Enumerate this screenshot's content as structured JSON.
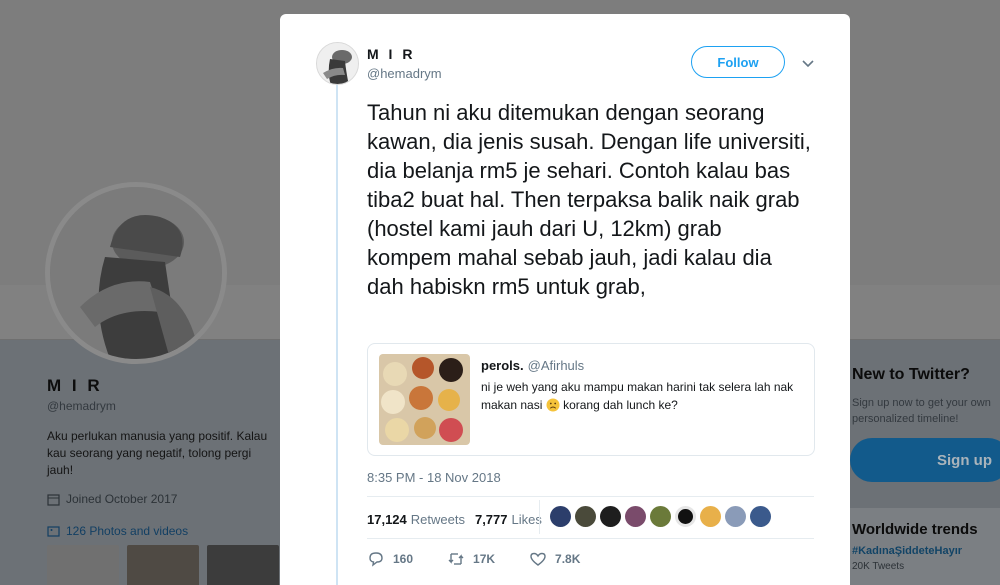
{
  "background_profile": {
    "name": "M I R",
    "handle": "@hemadrym",
    "bio": "Aku perlukan manusia yang positif. Kalau kau seorang yang negatif, tolong pergi jauh!",
    "joined": "Joined October 2017",
    "photos_link": "126 Photos and videos",
    "new_to_twitter_title": "New to Twitter?",
    "new_to_twitter_sub": "Sign up now to get your own personalized timeline!",
    "signup_button": "Sign up",
    "trends_title": "Worldwide trends",
    "trend_1": "#KadınaŞiddeteHayır",
    "trend_1_count": "20K Tweets"
  },
  "tweet": {
    "author_name": "M I R",
    "author_handle": "@hemadrym",
    "follow_label": "Follow",
    "text": "Tahun ni aku ditemukan dengan seorang kawan, dia jenis susah. Dengan life universiti, dia belanja rm5 je sehari. Contoh kalau bas tiba2 buat hal. Then terpaksa balik naik grab (hostel kami jauh dari U, 12km) grab kompem mahal sebab jauh, jadi kalau dia dah habiskn rm5 untuk grab,",
    "quote": {
      "name": "perols.",
      "handle": "@Afirhuls",
      "text_before_emoji": "ni je weh yang aku mampu makan harini tak selera lah nak makan nasi",
      "text_after_emoji": "korang dah lunch ke?"
    },
    "timestamp": "8:35 PM - 18 Nov 2018",
    "retweets_count": "17,124",
    "retweets_label": "Retweets",
    "likes_count": "7,777",
    "likes_label": "Likes",
    "reply_count": "160",
    "retweet_action_count": "17K",
    "like_action_count": "7.8K"
  },
  "colors": {
    "accent": "#1da1f2",
    "text": "#14171a",
    "muted": "#657786",
    "thread_line": "#cfe4f4"
  },
  "icons": [
    "calendar-icon",
    "photos-icon",
    "chevron-down-icon",
    "sad-face-emoji",
    "reply-icon",
    "retweet-icon",
    "like-icon"
  ]
}
